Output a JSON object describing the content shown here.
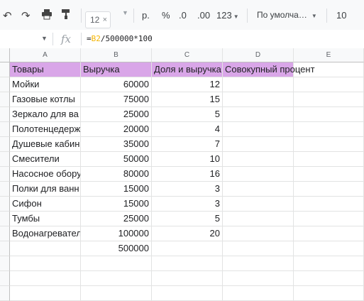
{
  "toolbar": {
    "undo_icon": "undo-icon",
    "redo_icon": "redo-icon",
    "print_icon": "print-icon",
    "paint_format_icon": "paint-format-icon",
    "font_size_hint": "12",
    "close_glyph": "×",
    "currency": "р.",
    "percent": "%",
    "decrease_decimals": ".0",
    "increase_decimals": ".00",
    "more_formats": "123",
    "font_family": "По умолча…",
    "font_size": "10"
  },
  "formula_bar": {
    "fx": "fx",
    "formula_prefix": "=",
    "formula_ref": "B2",
    "formula_rest": "/500000*100"
  },
  "columns": [
    "A",
    "B",
    "C",
    "D",
    "E"
  ],
  "sheet": {
    "header_color": "#d9a6e8",
    "header_row": [
      "Товары",
      "Выручка",
      "Доля и выручка",
      "Совокупный процент"
    ],
    "rows": [
      {
        "name": "Мойки",
        "revenue": "60000",
        "share": "12"
      },
      {
        "name": "Газовые котлы",
        "revenue": "75000",
        "share": "15"
      },
      {
        "name": "Зеркало для ва",
        "revenue": "25000",
        "share": "5"
      },
      {
        "name": "Полотенцедерж",
        "revenue": "20000",
        "share": "4"
      },
      {
        "name": "Душевые кабин",
        "revenue": "35000",
        "share": "7"
      },
      {
        "name": "Смесители",
        "revenue": "50000",
        "share": "10"
      },
      {
        "name": "Насосное обору",
        "revenue": "80000",
        "share": "16"
      },
      {
        "name": "Полки для ванн",
        "revenue": "15000",
        "share": "3"
      },
      {
        "name": "Сифон",
        "revenue": "15000",
        "share": "3"
      },
      {
        "name": "Тумбы",
        "revenue": "25000",
        "share": "5"
      },
      {
        "name": "Водонагревател",
        "revenue": "100000",
        "share": "20"
      }
    ],
    "total": "500000"
  }
}
